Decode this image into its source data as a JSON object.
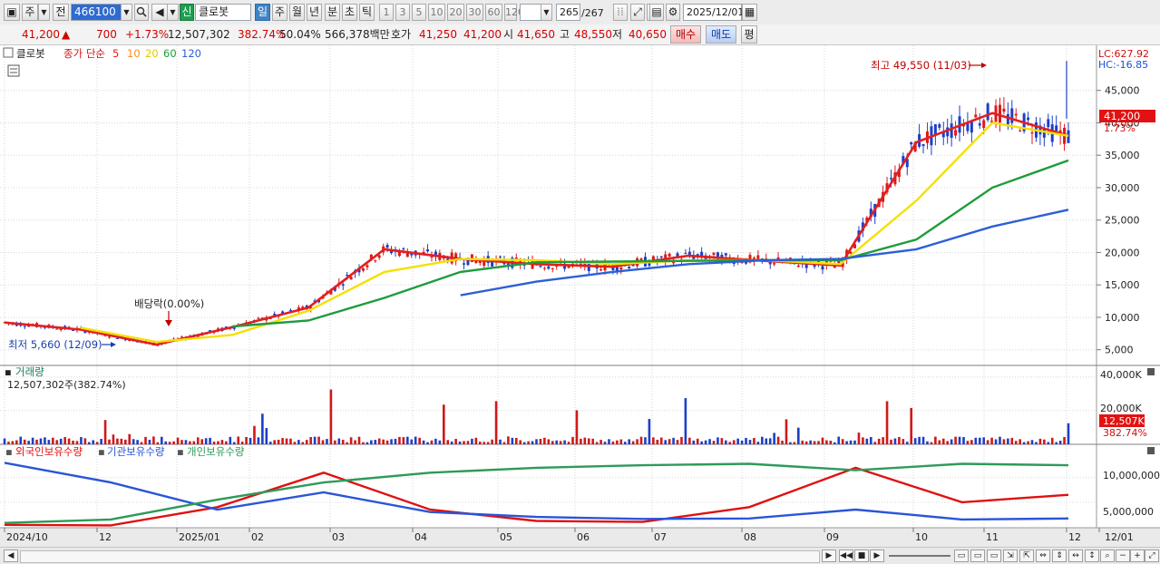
{
  "toolbar": {
    "market": "주",
    "prefix": "전",
    "code": "466100",
    "new_badge": "신",
    "stock_name": "클로봇",
    "periods": [
      "일",
      "주",
      "월",
      "년",
      "분",
      "초",
      "틱"
    ],
    "active_period": "일",
    "intervals": [
      "1",
      "3",
      "5",
      "10",
      "20",
      "30",
      "60",
      "120"
    ],
    "counter": "265",
    "counter_total": "/267",
    "date": "2025/12/01"
  },
  "quote": {
    "price": "41,200",
    "arrow": "▲",
    "change": "700",
    "change_pct": "+1.73%",
    "volume": "12,507,302",
    "volume_ratio": "382.74%",
    "turnover_ratio": "50.04%",
    "amount": "566,378백만",
    "ask_label": "호가",
    "ask": "41,250",
    "bid": "41,200",
    "open_label": "시",
    "open": "41,650",
    "high_label": "고",
    "high": "48,550",
    "low_label": "저",
    "low": "40,650",
    "buy_label": "매수",
    "sell_label": "매도",
    "eval_label": "평"
  },
  "price_panel": {
    "stock": "클로봇",
    "ma_title": "종가 단순",
    "ma_periods": [
      {
        "label": "5",
        "color": "#e02020"
      },
      {
        "label": "10",
        "color": "#ff8c1a"
      },
      {
        "label": "20",
        "color": "#f5e000"
      },
      {
        "label": "60",
        "color": "#1e9c3c"
      },
      {
        "label": "120",
        "color": "#2c5fd6"
      }
    ],
    "lc": "LC:627.92",
    "hc": "HC:-16.85",
    "high_note": "최고 49,550 (11/03)",
    "low_note": "최저 5,660 (12/09)",
    "dividend_note": "배당락(0.00%)",
    "current_price": "41,200",
    "current_pct": "1.73%",
    "axis_labels": [
      "45,000",
      "40,000",
      "35,000",
      "30,000",
      "25,000",
      "20,000",
      "15,000",
      "10,000",
      "5,000"
    ]
  },
  "volume_panel": {
    "title": "거래량",
    "info": "12,507,302주(382.74%)",
    "axis_labels": [
      "40,000K",
      "20,000K"
    ],
    "current": "12,507K",
    "current_pct": "382.74%"
  },
  "holdings_panel": {
    "legend": [
      {
        "label": "외국인보유수량",
        "color": "#e01010"
      },
      {
        "label": "기관보유수량",
        "color": "#2a55d8"
      },
      {
        "label": "개인보유수량",
        "color": "#2e9a5a"
      }
    ],
    "axis_labels": [
      "10,000,000",
      "5,000,000"
    ]
  },
  "x_axis": [
    "2024/10",
    "12",
    "2025/01",
    "02",
    "03",
    "04",
    "05",
    "06",
    "07",
    "08",
    "09",
    "10",
    "11",
    "12",
    "12/01"
  ],
  "chart_data": [
    {
      "type": "line",
      "title": "클로봇 종가 단순 이동평균",
      "x": [
        "2024/10",
        "2024/11",
        "2024/12",
        "2025/01",
        "2025/02",
        "2025/03",
        "2025/04",
        "2025/05",
        "2025/06",
        "2025/07",
        "2025/08",
        "2025/09",
        "2025/10",
        "2025/11",
        "2025/12"
      ],
      "series": [
        {
          "name": "5",
          "values": [
            9200,
            8100,
            5800,
            8500,
            11500,
            20500,
            19000,
            18200,
            17800,
            19500,
            18700,
            18000,
            37000,
            41500,
            38000
          ]
        },
        {
          "name": "20",
          "values": [
            null,
            8400,
            6200,
            7300,
            11000,
            17000,
            19000,
            18800,
            18200,
            18800,
            18800,
            18200,
            28000,
            40000,
            38000
          ]
        },
        {
          "name": "60",
          "values": [
            null,
            null,
            null,
            8600,
            9500,
            13000,
            17000,
            18500,
            18600,
            18700,
            18800,
            18800,
            22000,
            30000,
            34200
          ]
        },
        {
          "name": "120",
          "values": [
            null,
            null,
            null,
            null,
            null,
            null,
            13400,
            15500,
            17000,
            18200,
            18800,
            19000,
            20500,
            24000,
            26600
          ]
        }
      ],
      "annotations": {
        "high": 49550,
        "low": 5660,
        "current": 41200
      },
      "ylim": [
        3000,
        50000
      ]
    },
    {
      "type": "bar",
      "title": "거래량",
      "x": [
        "2025/01",
        "2025/02",
        "2025/03",
        "2025/06",
        "2025/09",
        "2025/10",
        "2025/11",
        "2025/12/01"
      ],
      "values": [
        33000,
        40000,
        28000,
        22000,
        18000,
        24000,
        21000,
        12507
      ],
      "ylim": [
        0,
        42000
      ]
    },
    {
      "type": "line",
      "title": "보유수량",
      "x": [
        "2024/10",
        "2024/12",
        "2025/01",
        "2025/02",
        "2025/03",
        "2025/05",
        "2025/07",
        "2025/09",
        "2025/10",
        "2025/11",
        "2025/12"
      ],
      "series": [
        {
          "name": "외국인보유수량",
          "values": [
            400000,
            300000,
            4000000,
            11000000,
            3500000,
            1200000,
            1000000,
            4000000,
            12000000,
            5000000,
            6500000
          ]
        },
        {
          "name": "기관보유수량",
          "values": [
            13000000,
            9000000,
            3500000,
            7000000,
            3000000,
            2000000,
            1600000,
            1700000,
            3500000,
            1500000,
            1700000
          ]
        },
        {
          "name": "개인보유수량",
          "values": [
            800000,
            1500000,
            5500000,
            9000000,
            11000000,
            12000000,
            12500000,
            12800000,
            11500000,
            12800000,
            12500000
          ]
        }
      ],
      "ylim": [
        0,
        14000000
      ]
    }
  ]
}
